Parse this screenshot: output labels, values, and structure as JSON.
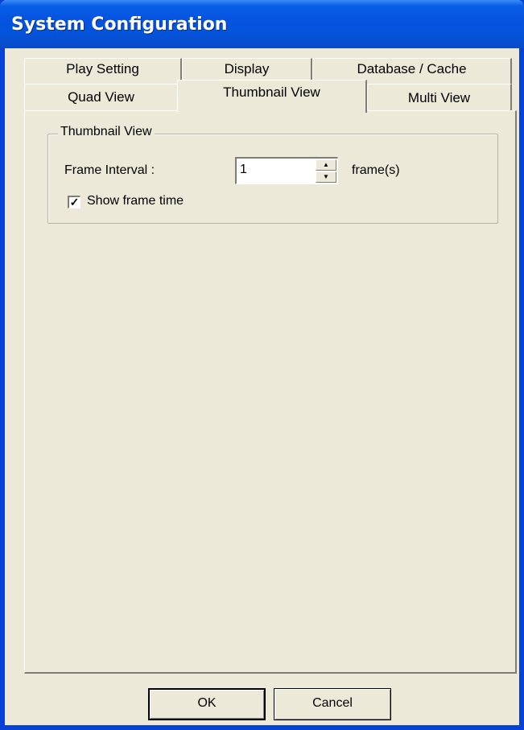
{
  "window": {
    "title": "System Configuration"
  },
  "tabs": {
    "row1": [
      {
        "label": "Play Setting"
      },
      {
        "label": "Display"
      },
      {
        "label": "Database / Cache"
      }
    ],
    "row2": [
      {
        "label": "Quad View"
      },
      {
        "label": "Thumbnail View",
        "active": true
      },
      {
        "label": "Multi View"
      }
    ]
  },
  "thumbnail_view": {
    "group_title": "Thumbnail View",
    "frame_interval_label": "Frame Interval :",
    "frame_interval_value": "1",
    "frame_unit": "frame(s)",
    "show_frame_time_label": "Show frame time",
    "show_frame_time_checked": true
  },
  "buttons": {
    "ok_label": "OK",
    "cancel_label": "Cancel"
  },
  "colors": {
    "titlebar_blue": "#0553e0",
    "dialog_face": "#ece9d8"
  }
}
